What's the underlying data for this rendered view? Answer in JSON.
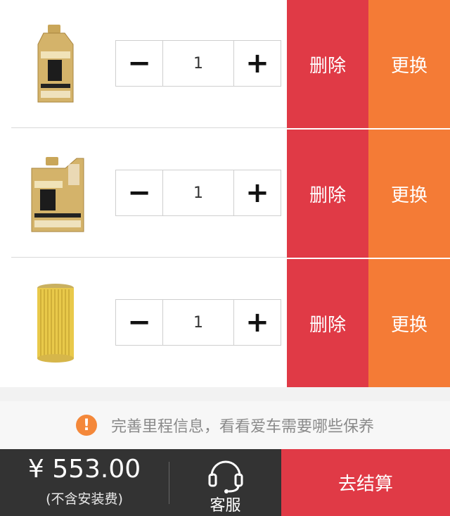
{
  "colors": {
    "delete": "#e03a46",
    "replace": "#f47b36",
    "checkout": "#e03a46",
    "footer": "#333333",
    "notice_icon": "#f4883a"
  },
  "cart": {
    "items": [
      {
        "image_icon": "oil-bottle-1l-icon",
        "quantity": "1",
        "minus": "−",
        "plus": "+",
        "delete_label": "删除",
        "replace_label": "更换"
      },
      {
        "image_icon": "oil-jug-4l-icon",
        "quantity": "1",
        "minus": "−",
        "plus": "+",
        "delete_label": "删除",
        "replace_label": "更换"
      },
      {
        "image_icon": "oil-filter-icon",
        "quantity": "1",
        "minus": "−",
        "plus": "+",
        "delete_label": "删除",
        "replace_label": "更换"
      }
    ]
  },
  "notice": {
    "icon": "exclamation-icon",
    "icon_glyph": "!",
    "text": "完善里程信息，看看爱车需要哪些保养"
  },
  "footer": {
    "price": "¥ 553.00",
    "price_note": "(不含安装费)",
    "service_label": "客服",
    "service_icon": "headset-icon",
    "checkout_label": "去结算"
  }
}
